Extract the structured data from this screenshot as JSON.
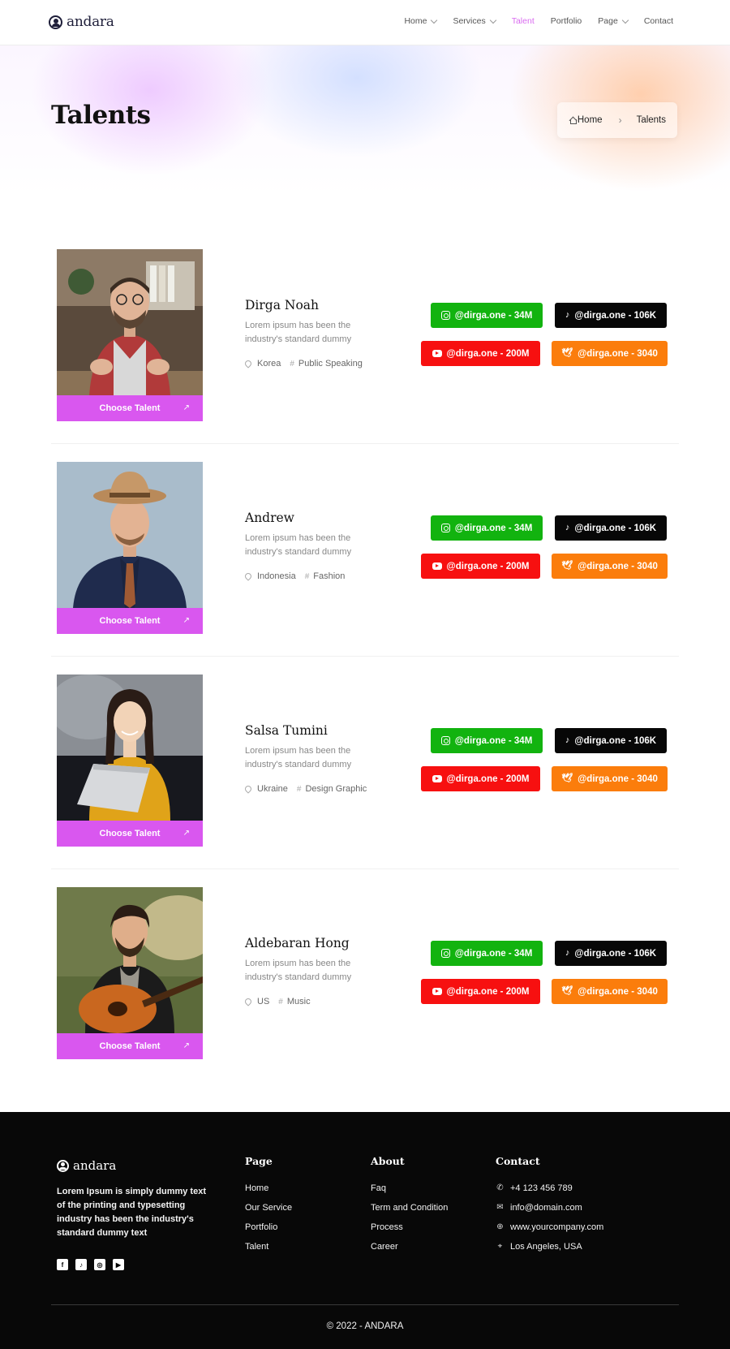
{
  "header": {
    "logo_text": "andara",
    "nav": [
      {
        "label": "Home",
        "dropdown": true,
        "active": false
      },
      {
        "label": "Services",
        "dropdown": true,
        "active": false
      },
      {
        "label": "Talent",
        "dropdown": false,
        "active": true
      },
      {
        "label": "Portfolio",
        "dropdown": false,
        "active": false
      },
      {
        "label": "Page",
        "dropdown": true,
        "active": false
      },
      {
        "label": "Contact",
        "dropdown": false,
        "active": false
      }
    ]
  },
  "hero": {
    "title": "Talents",
    "breadcrumb": {
      "home": "Home",
      "current": "Talents"
    }
  },
  "talents": [
    {
      "name": "Dirga Noah",
      "description": "Lorem ipsum has been the industry's standard dummy",
      "location": "Korea",
      "category": "Public Speaking",
      "cta": "Choose Talent",
      "socials": {
        "instagram": "@dirga.one - 34M",
        "tiktok": "@dirga.one - 106K",
        "youtube": "@dirga.one - 200M",
        "twitter": "@dirga.one - 3040"
      }
    },
    {
      "name": "Andrew",
      "description": "Lorem ipsum has been the industry's standard dummy",
      "location": "Indonesia",
      "category": "Fashion",
      "cta": "Choose Talent",
      "socials": {
        "instagram": "@dirga.one - 34M",
        "tiktok": "@dirga.one - 106K",
        "youtube": "@dirga.one - 200M",
        "twitter": "@dirga.one - 3040"
      }
    },
    {
      "name": "Salsa Tumini",
      "description": "Lorem ipsum has been the industry's standard dummy",
      "location": "Ukraine",
      "category": "Design Graphic",
      "cta": "Choose Talent",
      "socials": {
        "instagram": "@dirga.one - 34M",
        "tiktok": "@dirga.one - 106K",
        "youtube": "@dirga.one - 200M",
        "twitter": "@dirga.one - 3040"
      }
    },
    {
      "name": "Aldebaran Hong",
      "description": "Lorem ipsum has been the industry's standard dummy",
      "location": "US",
      "category": "Music",
      "cta": "Choose Talent",
      "socials": {
        "instagram": "@dirga.one - 34M",
        "tiktok": "@dirga.one - 106K",
        "youtube": "@dirga.one - 200M",
        "twitter": "@dirga.one - 3040"
      }
    }
  ],
  "footer": {
    "logo_text": "andara",
    "about": "Lorem Ipsum is simply dummy text of the printing and typesetting industry has been the industry's standard dummy text",
    "page": {
      "title": "Page",
      "links": [
        "Home",
        "Our Service",
        "Portfolio",
        "Talent"
      ]
    },
    "about_col": {
      "title": "About",
      "links": [
        "Faq",
        "Term and Condition",
        "Process",
        "Career"
      ]
    },
    "contact": {
      "title": "Contact",
      "phone": "+4 123 456 789",
      "email": "info@domain.com",
      "website": "www.yourcompany.com",
      "address": "Los Angeles, USA"
    },
    "copyright": "© 2022 - ANDARA"
  },
  "colors": {
    "accent": "#d957ef",
    "instagram": "#12b30f",
    "tiktok": "#070707",
    "youtube": "#f71010",
    "twitter": "#fb7d0c"
  }
}
